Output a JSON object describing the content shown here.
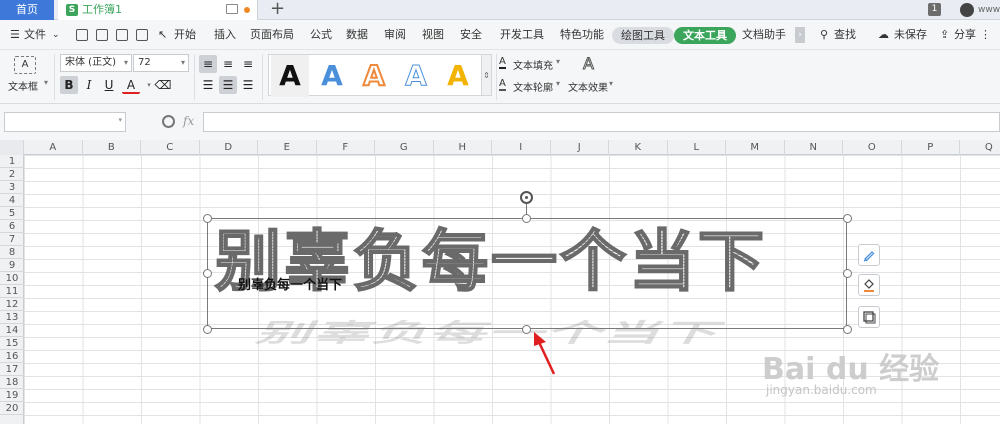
{
  "tabs": {
    "home": "首页",
    "doc": "工作簿1",
    "doc_icon_letter": "S",
    "add": "+",
    "badge": "1",
    "user": "www"
  },
  "menu": {
    "file": "文件",
    "items": [
      "开始",
      "插入",
      "页面布局",
      "公式",
      "数据",
      "审阅",
      "视图",
      "安全",
      "开发工具",
      "特色功能"
    ],
    "drawing_tools": "绘图工具",
    "text_tools": "文本工具",
    "doc_helper": "文档助手",
    "search": "查找",
    "unsaved": "未保存",
    "share": "分享"
  },
  "ribbon": {
    "textbox_label": "文本框",
    "font_name": "宋体 (正文)",
    "font_size": "72",
    "bold": "B",
    "italic": "I",
    "underline": "U",
    "font_color": "A",
    "gallery_letter": "A",
    "text_fill": "文本填充",
    "text_outline": "文本轮廓",
    "text_effect": "文本效果"
  },
  "formula": {
    "fx": "fx"
  },
  "columns": [
    "A",
    "B",
    "C",
    "D",
    "E",
    "F",
    "G",
    "H",
    "I",
    "J",
    "K",
    "L",
    "M",
    "N",
    "O",
    "P",
    "Q"
  ],
  "rows": [
    "1",
    "2",
    "3",
    "4",
    "5",
    "6",
    "7",
    "8",
    "9",
    "10",
    "11",
    "12",
    "13",
    "14",
    "15",
    "16",
    "17",
    "18",
    "19",
    "20"
  ],
  "textbox": {
    "art_text": "别辜负每一个当下",
    "small_text": "别辜负每一个当下"
  },
  "watermark": {
    "brand": "Bai du 经验",
    "url": "jingyan.baidu.com"
  },
  "colors": {
    "accent_blue": "#3e78d8",
    "accent_green": "#3aa55b",
    "arrow_red": "#e02020"
  }
}
